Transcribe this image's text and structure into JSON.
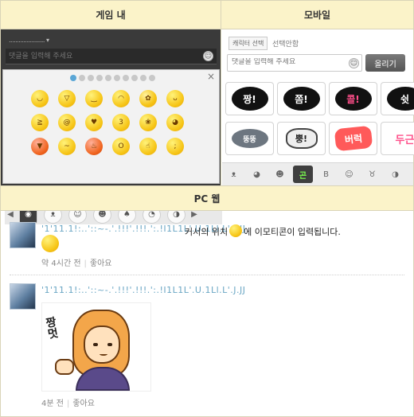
{
  "headers": {
    "game": "게임 내",
    "mobile": "모바일",
    "pc": "PC 웹"
  },
  "game": {
    "user_line": "...................... ▾",
    "comment_placeholder": "댓글을 입력해 주세요",
    "close": "×",
    "emoticons_rows": 3,
    "page_dots": 10,
    "arrow_left": "◀",
    "arrow_right": "▶"
  },
  "mobile": {
    "char_select_label": "캐릭터 선택",
    "char_none_label": "선택안함",
    "comment_placeholder": "댓글을 입력해 주세요",
    "post_button": "올리기",
    "stickers": [
      {
        "text": "짱!",
        "style": "black"
      },
      {
        "text": "쫌!",
        "style": "black"
      },
      {
        "text": "콜!",
        "style": "black"
      },
      {
        "text": "쉿",
        "style": "black"
      },
      {
        "text": "뚱뚱",
        "style": "cloud"
      },
      {
        "text": "뿡!",
        "style": "grey"
      },
      {
        "text": "버럭",
        "style": "burst"
      },
      {
        "text": "두근",
        "style": "plain"
      }
    ],
    "selected_tab_label": "곤"
  },
  "pc": {
    "comments": [
      {
        "username": "'1'11.1!:..'::~-.'.!!!'.!!!.':.!I1L1L'.U.1Ll.L'.J.JJ",
        "text_before": "커서의 위치",
        "text_after": "에 이모티콘이 입력됩니다.",
        "time": "약 4시간 전",
        "like": "좋아요"
      },
      {
        "username": "'1'11.1!:..'::~-.'.!!!'.!!!.':.!I1L1L'.U.1Ll.L'.J.JJ",
        "sticker_text": "짱\n멋",
        "time": "4분 전",
        "like": "좋아요"
      }
    ]
  },
  "colors": {
    "header_bg": "#fbf3c9",
    "border": "#d9d4b8",
    "username": "#6aa6c4",
    "dot_active": "#5aa6d6"
  }
}
